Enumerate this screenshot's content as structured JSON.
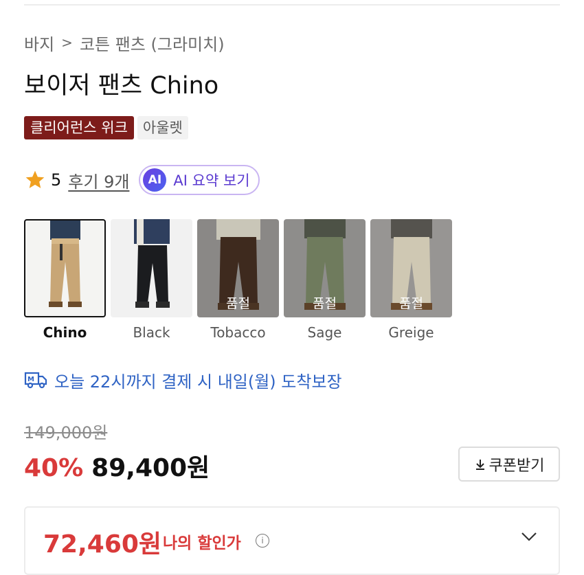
{
  "breadcrumb": {
    "category": "바지",
    "separator": ">",
    "subcategory": "코튼 팬츠 (그라미치)"
  },
  "product": {
    "title": "보이저 팬츠 Chino",
    "badges": [
      "클리어런스 위크",
      "아울렛"
    ]
  },
  "rating": {
    "score": "5",
    "reviews_label": "후기 9개",
    "ai_icon": "AI",
    "ai_label": "AI 요약 보기"
  },
  "colors": [
    {
      "name": "Chino",
      "selected": true,
      "status": "",
      "bg": "#f4f4f2",
      "pant": "#c8a676",
      "top": "#2c3e57"
    },
    {
      "name": "Black",
      "selected": false,
      "status": "",
      "bg": "#f1f1f1",
      "pant": "#1b1c1f",
      "top": "#2f3f5e"
    },
    {
      "name": "Tobacco",
      "selected": false,
      "status": "품절",
      "bg": "#8a8886",
      "pant": "#3e2a1e",
      "top": "#c9c6b8"
    },
    {
      "name": "Sage",
      "selected": false,
      "status": "품절",
      "bg": "#8e8d8b",
      "pant": "#6f7b5d",
      "top": "#4d5246"
    },
    {
      "name": "Greige",
      "selected": false,
      "status": "품절",
      "bg": "#979593",
      "pant": "#cfc8b3",
      "top": "#55534e"
    }
  ],
  "delivery": {
    "icon": "delivery-truck-icon",
    "text": "오늘 22시까지 결제 시 내일(월) 도착보장"
  },
  "pricing": {
    "original": "149,000원",
    "discount": "40%",
    "price": "89,400원",
    "coupon_label": "쿠폰받기",
    "my_price": "72,460원",
    "my_price_label": "나의 할인가",
    "info_icon": "i"
  },
  "theme": {
    "accent_red": "#d93a3a",
    "badge_red": "#7d1c1a",
    "link_blue": "#2f63c4",
    "ai_purple": "#5a3ad0",
    "star": "#f0a020"
  }
}
